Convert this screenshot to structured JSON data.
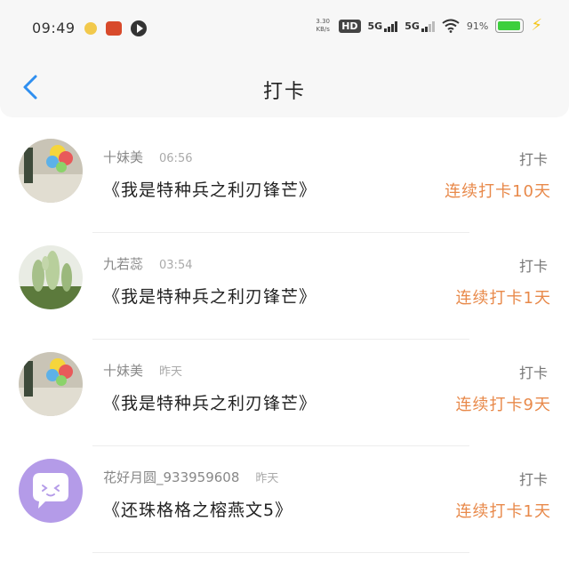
{
  "status_bar": {
    "time": "09:49",
    "net_speed_value": "3.30",
    "net_speed_unit": "KB/s",
    "hd_label": "HD",
    "signal1_label": "5G",
    "signal2_label": "5G",
    "battery_percent": "91%"
  },
  "header": {
    "title": "打卡"
  },
  "items": [
    {
      "name": "十妹美",
      "time": "06:56",
      "title": "《我是特种兵之利刃锋芒》",
      "action": "打卡",
      "streak": "连续打卡10天"
    },
    {
      "name": "九若蕊",
      "time": "03:54",
      "title": "《我是特种兵之利刃锋芒》",
      "action": "打卡",
      "streak": "连续打卡1天"
    },
    {
      "name": "十妹美",
      "time": "昨天",
      "title": "《我是特种兵之利刃锋芒》",
      "action": "打卡",
      "streak": "连续打卡9天"
    },
    {
      "name": "花好月圆_933959608",
      "time": "昨天",
      "title": "《还珠格格之榕燕文5》",
      "action": "打卡",
      "streak": "连续打卡1天"
    }
  ],
  "colors": {
    "accent": "#2f8ff0",
    "streak": "#e8894a",
    "avatar_purple": "#b49be8"
  }
}
